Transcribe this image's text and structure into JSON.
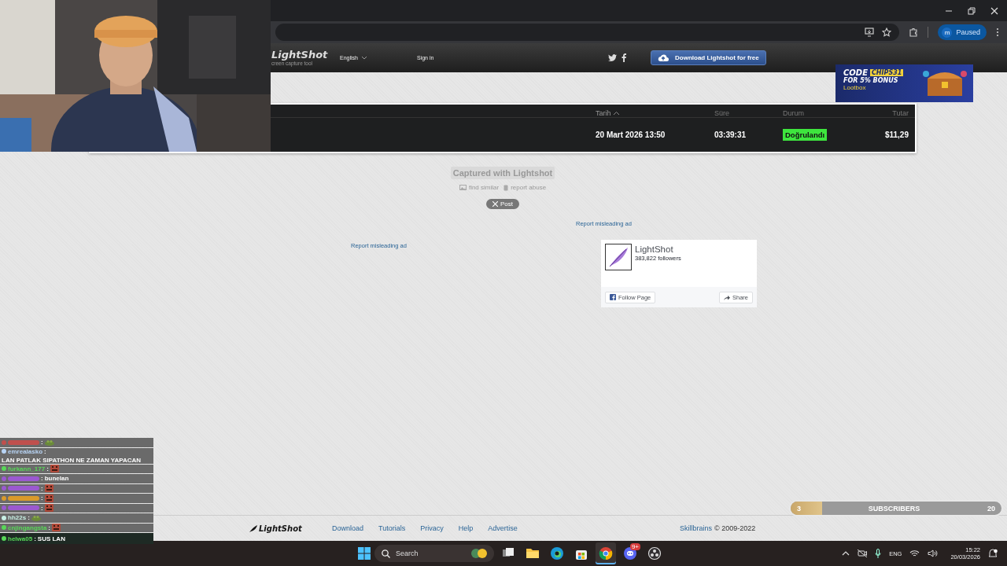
{
  "browser": {
    "profile_initial": "m",
    "profile_status": "Paused"
  },
  "site_header": {
    "logo": "LightShot",
    "tagline": "creen capture tool",
    "language": "English",
    "sign_in": "Sign in",
    "download_button": "Download Lightshot for free"
  },
  "ad_banner": {
    "code_label": "CODE",
    "code": "CHIPS31",
    "bonus": "FOR 5% BONUS",
    "brand": "Lootbox"
  },
  "screenshot": {
    "columns": [
      {
        "label": "Tarih",
        "sorted": true
      },
      {
        "label": "Süre",
        "sorted": false
      },
      {
        "label": "Durum",
        "sorted": false
      },
      {
        "label": "Tutar",
        "sorted": false
      }
    ],
    "rows": [
      {
        "date": "20 Mart 2026 13:50",
        "duration": "03:39:31",
        "status": "Doğrulandı",
        "amount": "$11,29"
      }
    ]
  },
  "capture_info": {
    "caption": "Captured with Lightshot",
    "find_similar": "find similar",
    "report_abuse": "report abuse",
    "post_button": "Post"
  },
  "ads": {
    "report_links": [
      "Report misleading ad",
      "Report misleading ad"
    ]
  },
  "facebook_widget": {
    "page": "LightShot",
    "followers": "383,822 followers",
    "follow": "Follow Page",
    "share": "Share"
  },
  "footer": {
    "logo": "LightShot",
    "links": [
      "Download",
      "Tutorials",
      "Privacy",
      "Help",
      "Advertise"
    ],
    "company": "Skillbrains",
    "copyright": "© 2009-2022"
  },
  "taskbar": {
    "search_placeholder": "Search",
    "apps": [
      {
        "kind": "taskview",
        "selected": false
      },
      {
        "kind": "explorer",
        "selected": false
      },
      {
        "kind": "edge",
        "selected": false
      },
      {
        "kind": "store",
        "selected": false
      },
      {
        "kind": "chrome",
        "selected": true
      },
      {
        "kind": "discord",
        "selected": false,
        "badge": "9+"
      },
      {
        "kind": "obs",
        "selected": false
      }
    ],
    "language": "ENG",
    "time": "15:22",
    "date": "20/03/2026"
  },
  "chat": {
    "messages": [
      {
        "color": "#c0504d",
        "separator": ":",
        "kind": "frog",
        "highlight": false
      },
      {
        "user": "emrealasko",
        "color": "#b8d4f5",
        "separator": ":",
        "text": "LAN PATLAK SIPATHON NE ZAMAN YAPACAN",
        "kind": "text",
        "highlight": false
      },
      {
        "user": "furkann_177",
        "color": "#58d858",
        "separator": ":",
        "kind": "face",
        "highlight": false
      },
      {
        "color": "#9b59d0",
        "separator": ":",
        "text": "bunelan",
        "kind": "text",
        "highlight": false
      },
      {
        "color": "#9b59d0",
        "separator": ":",
        "kind": "face",
        "highlight": false
      },
      {
        "color": "#d99a2b",
        "separator": ":",
        "kind": "face",
        "highlight": false
      },
      {
        "color": "#9b59d0",
        "separator": ":",
        "kind": "face",
        "highlight": false
      },
      {
        "user": "hh22s",
        "color": "#c8f0e4",
        "separator": ":",
        "kind": "frog",
        "highlight": false
      },
      {
        "user": "cnjingangsta",
        "color": "#58d858",
        "separator": ":",
        "kind": "face",
        "highlight": false
      },
      {
        "user": "helwa05",
        "color": "#58d858",
        "separator": ":",
        "text": "SUS LAN",
        "kind": "text",
        "highlight": true
      }
    ]
  },
  "subscriber_goal": {
    "current": "3",
    "label": "SUBSCRIBERS",
    "target": "20",
    "level": 0.15
  }
}
